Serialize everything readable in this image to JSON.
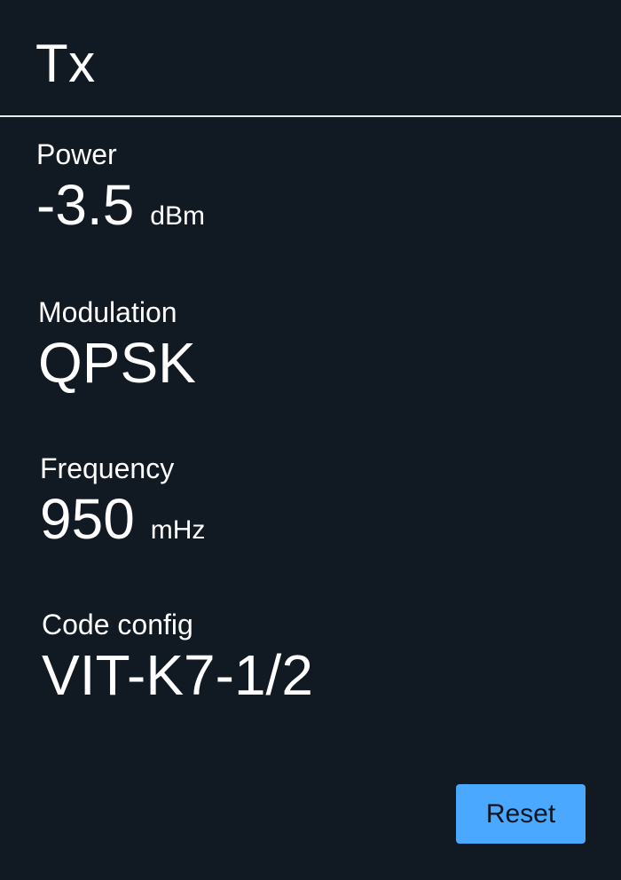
{
  "panel": {
    "title": "Tx"
  },
  "fields": {
    "power": {
      "label": "Power",
      "value": "-3.5",
      "unit": "dBm"
    },
    "modulation": {
      "label": "Modulation",
      "value": "QPSK"
    },
    "frequency": {
      "label": "Frequency",
      "value": "950",
      "unit": "mHz"
    },
    "code_config": {
      "label": "Code config",
      "value": "VIT-K7-1/2"
    }
  },
  "actions": {
    "reset_label": "Reset"
  },
  "colors": {
    "background": "#111923",
    "text": "#ffffff",
    "divider": "#e8ecef",
    "button_bg": "#4aa8ff",
    "button_text": "#0d1520"
  }
}
